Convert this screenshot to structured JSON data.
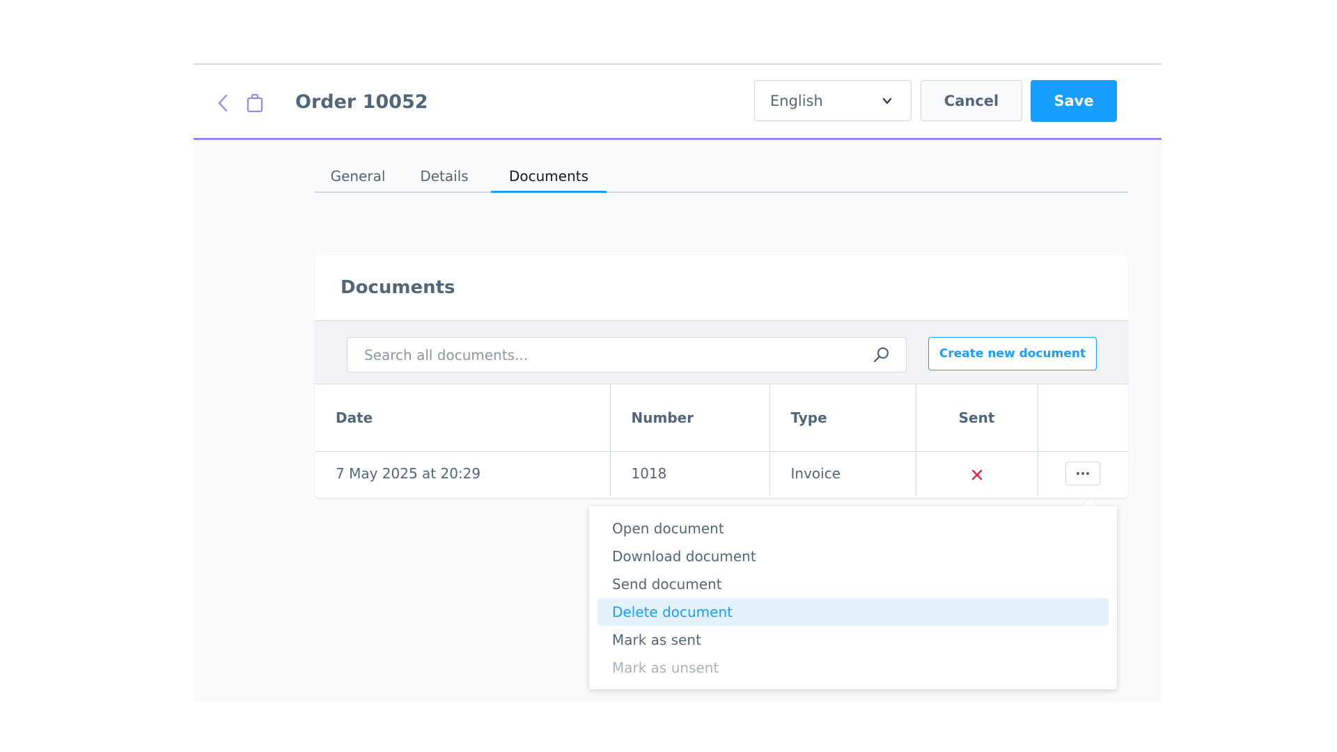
{
  "header": {
    "title": "Order 10052",
    "language": "English",
    "cancel_label": "Cancel",
    "save_label": "Save"
  },
  "tabs": [
    {
      "label": "General",
      "active": false
    },
    {
      "label": "Details",
      "active": false
    },
    {
      "label": "Documents",
      "active": true
    }
  ],
  "documents": {
    "title": "Documents",
    "search_placeholder": "Search all documents...",
    "create_label": "Create new document",
    "columns": [
      "Date",
      "Number",
      "Type",
      "Sent"
    ],
    "rows": [
      {
        "date": "7 May 2025 at 20:29",
        "number": "1018",
        "type": "Invoice",
        "sent": false
      }
    ]
  },
  "context_menu": {
    "items": [
      {
        "label": "Open document",
        "state": "normal"
      },
      {
        "label": "Download document",
        "state": "normal"
      },
      {
        "label": "Send document",
        "state": "normal"
      },
      {
        "label": "Delete document",
        "state": "highlighted"
      },
      {
        "label": "Mark as sent",
        "state": "normal"
      },
      {
        "label": "Mark as unsent",
        "state": "disabled"
      }
    ]
  },
  "colors": {
    "accent": "#189eff",
    "header_border": "#9b87e6",
    "error": "#de294c",
    "text": "#52667a"
  },
  "icons": {
    "back": "chevron-left-icon",
    "order": "shopping-bag-icon",
    "dropdown": "chevron-down-icon",
    "search": "search-icon",
    "not_sent": "x-icon",
    "more": "more-horizontal-icon"
  }
}
